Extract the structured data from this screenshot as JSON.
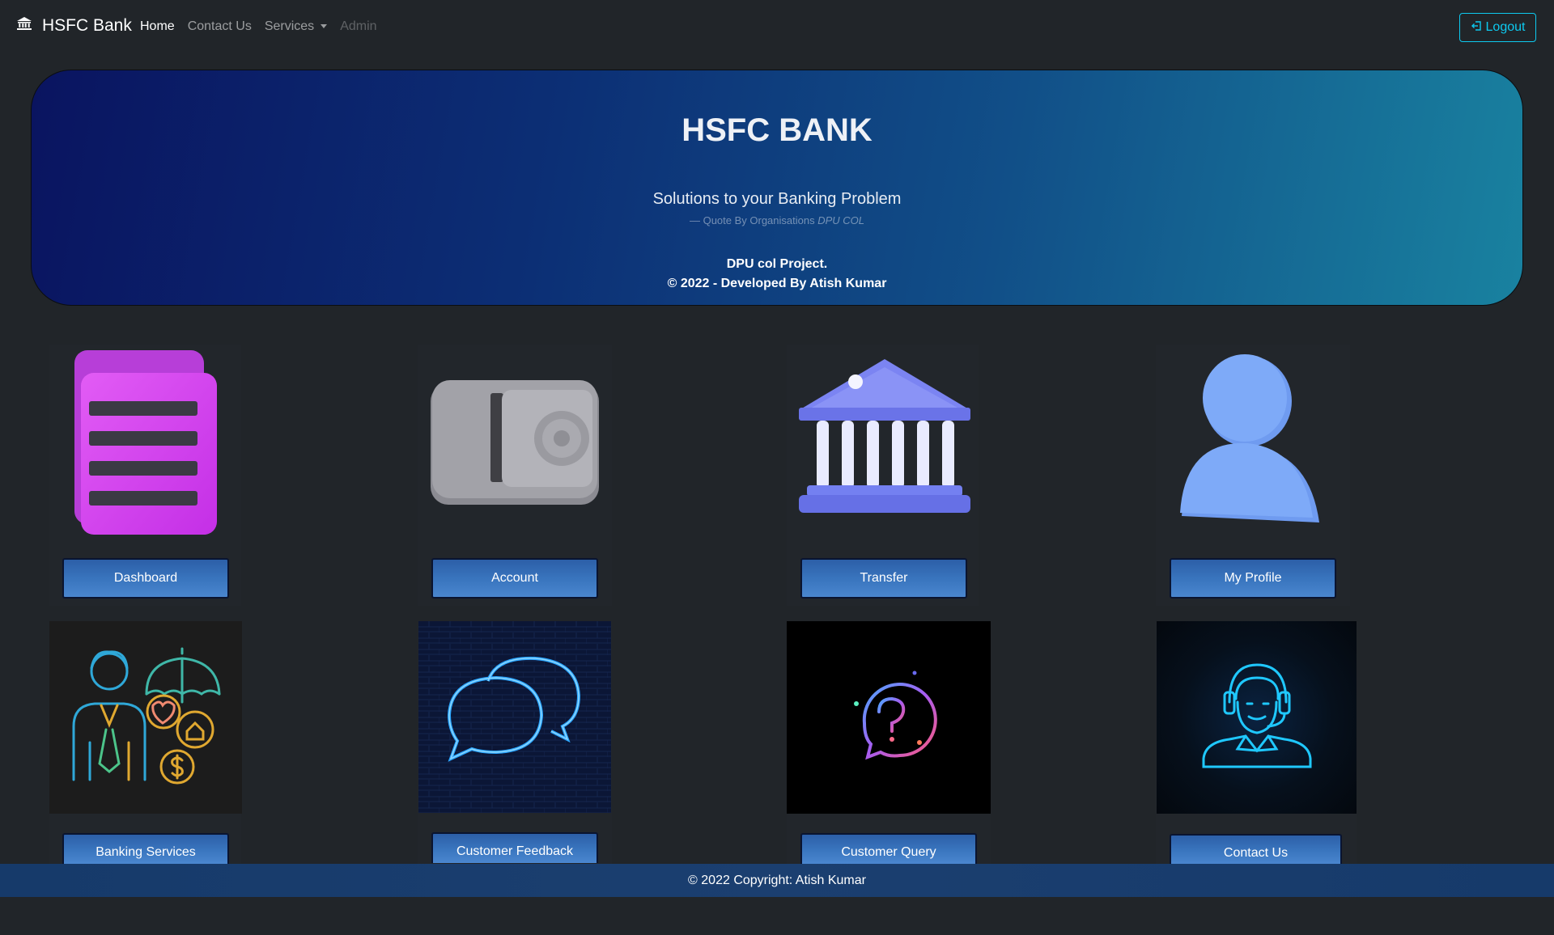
{
  "navbar": {
    "brand_icon": "bank-icon",
    "brand": "HSFC Bank",
    "links": [
      "Home",
      "Contact Us",
      "Services",
      "Admin"
    ],
    "logout_icon": "logout-icon",
    "logout": "Logout"
  },
  "hero": {
    "title": "HSFC BANK",
    "subtitle": "Solutions to your Banking Problem",
    "quote_prefix": "— Quote By Organisations",
    "quote_source": "DPU COL",
    "line1": "DPU col Project.",
    "line2": "© 2022 - Developed By Atish Kumar"
  },
  "cards": [
    {
      "label": "Dashboard",
      "icon": "document-list-icon"
    },
    {
      "label": "Account",
      "icon": "safe-vault-icon"
    },
    {
      "label": "Transfer",
      "icon": "bank-building-icon"
    },
    {
      "label": "My Profile",
      "icon": "user-profile-icon"
    },
    {
      "label": "Banking Services",
      "icon": "banking-services-icon"
    },
    {
      "label": "Customer Feedback",
      "icon": "speech-bubbles-icon"
    },
    {
      "label": "Customer Query",
      "icon": "question-bubble-icon"
    },
    {
      "label": "Contact Us",
      "icon": "headset-agent-icon"
    }
  ],
  "footer": {
    "text": "© 2022 Copyright: Atish Kumar"
  }
}
